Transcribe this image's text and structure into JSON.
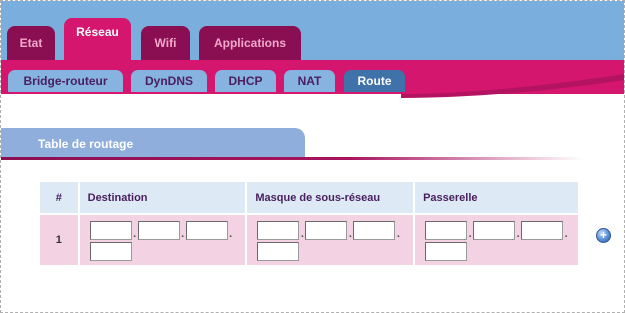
{
  "nav": {
    "main_tabs": [
      {
        "label": "Etat"
      },
      {
        "label": "Réseau"
      },
      {
        "label": "Wifi"
      },
      {
        "label": "Applications"
      }
    ],
    "active_main": "Réseau",
    "sub_tabs": [
      {
        "label": "Bridge-routeur"
      },
      {
        "label": "DynDNS"
      },
      {
        "label": "DHCP"
      },
      {
        "label": "NAT"
      },
      {
        "label": "Route"
      }
    ],
    "active_sub": "Route"
  },
  "section": {
    "title": "Table de routage"
  },
  "table": {
    "headers": [
      "#",
      "Destination",
      "Masque de sous-réseau",
      "Passerelle"
    ],
    "rows": [
      {
        "num": "1",
        "destination": [
          "",
          "",
          "",
          ""
        ],
        "mask": [
          "",
          "",
          "",
          ""
        ],
        "gateway": [
          "",
          "",
          "",
          ""
        ]
      }
    ],
    "ip_separator": "."
  },
  "actions": {
    "add_symbol": "+",
    "add_icon": "plus-circle-icon"
  },
  "colors": {
    "header_blue": "#7aaedc",
    "brand_magenta": "#d5166e",
    "tab_dark": "#8a0f52",
    "subtab_blue": "#86b3e0",
    "subtab_active": "#3f72a8",
    "table_header_bg": "#dde9f5",
    "table_row_bg": "#f2d2e3"
  }
}
